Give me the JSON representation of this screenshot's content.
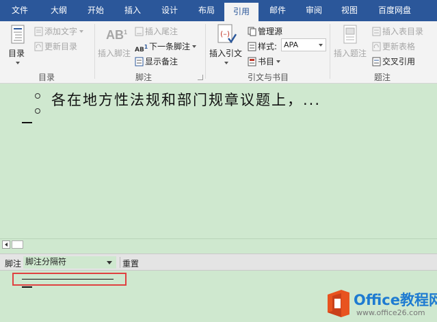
{
  "tabs": [
    {
      "label": "文件",
      "active": false
    },
    {
      "label": "大纲",
      "active": false
    },
    {
      "label": "开始",
      "active": false
    },
    {
      "label": "插入",
      "active": false
    },
    {
      "label": "设计",
      "active": false
    },
    {
      "label": "布局",
      "active": false
    },
    {
      "label": "引用",
      "active": true
    },
    {
      "label": "邮件",
      "active": false
    },
    {
      "label": "审阅",
      "active": false
    },
    {
      "label": "视图",
      "active": false
    },
    {
      "label": "百度网盘",
      "active": false
    }
  ],
  "ribbon": {
    "toc": {
      "big_button": "目录",
      "add_text": "添加文字",
      "update_toc": "更新目录",
      "group_label": "目录"
    },
    "footnotes": {
      "insert_footnote": "插入脚注",
      "insert_endnote": "插入尾注",
      "next_footnote": "下一条脚注",
      "show_notes": "显示备注",
      "group_label": "脚注"
    },
    "citations": {
      "insert_citation": "插入引文",
      "manage_sources": "管理源",
      "style_label": "样式:",
      "style_value": "APA",
      "bibliography": "书目",
      "group_label": "引文与书目"
    },
    "captions": {
      "insert_caption": "插入题注",
      "insert_table_of_figures": "插入表目录",
      "update_table": "更新表格",
      "cross_reference": "交叉引用",
      "group_label": "题注"
    }
  },
  "document": {
    "line1": "各在地方性法规和部门规章议题上，..."
  },
  "footnote_pane": {
    "label": "脚注",
    "selected": "脚注分隔符",
    "reset": "重置"
  },
  "watermark": {
    "title": "Office教程网",
    "url": "www.office26.com"
  },
  "colors": {
    "tab_bar": "#2b579a",
    "doc_bg": "#cfe8cf",
    "highlight": "#e04040",
    "watermark_orange": "#e8531f",
    "watermark_blue": "#1e7bd1"
  }
}
